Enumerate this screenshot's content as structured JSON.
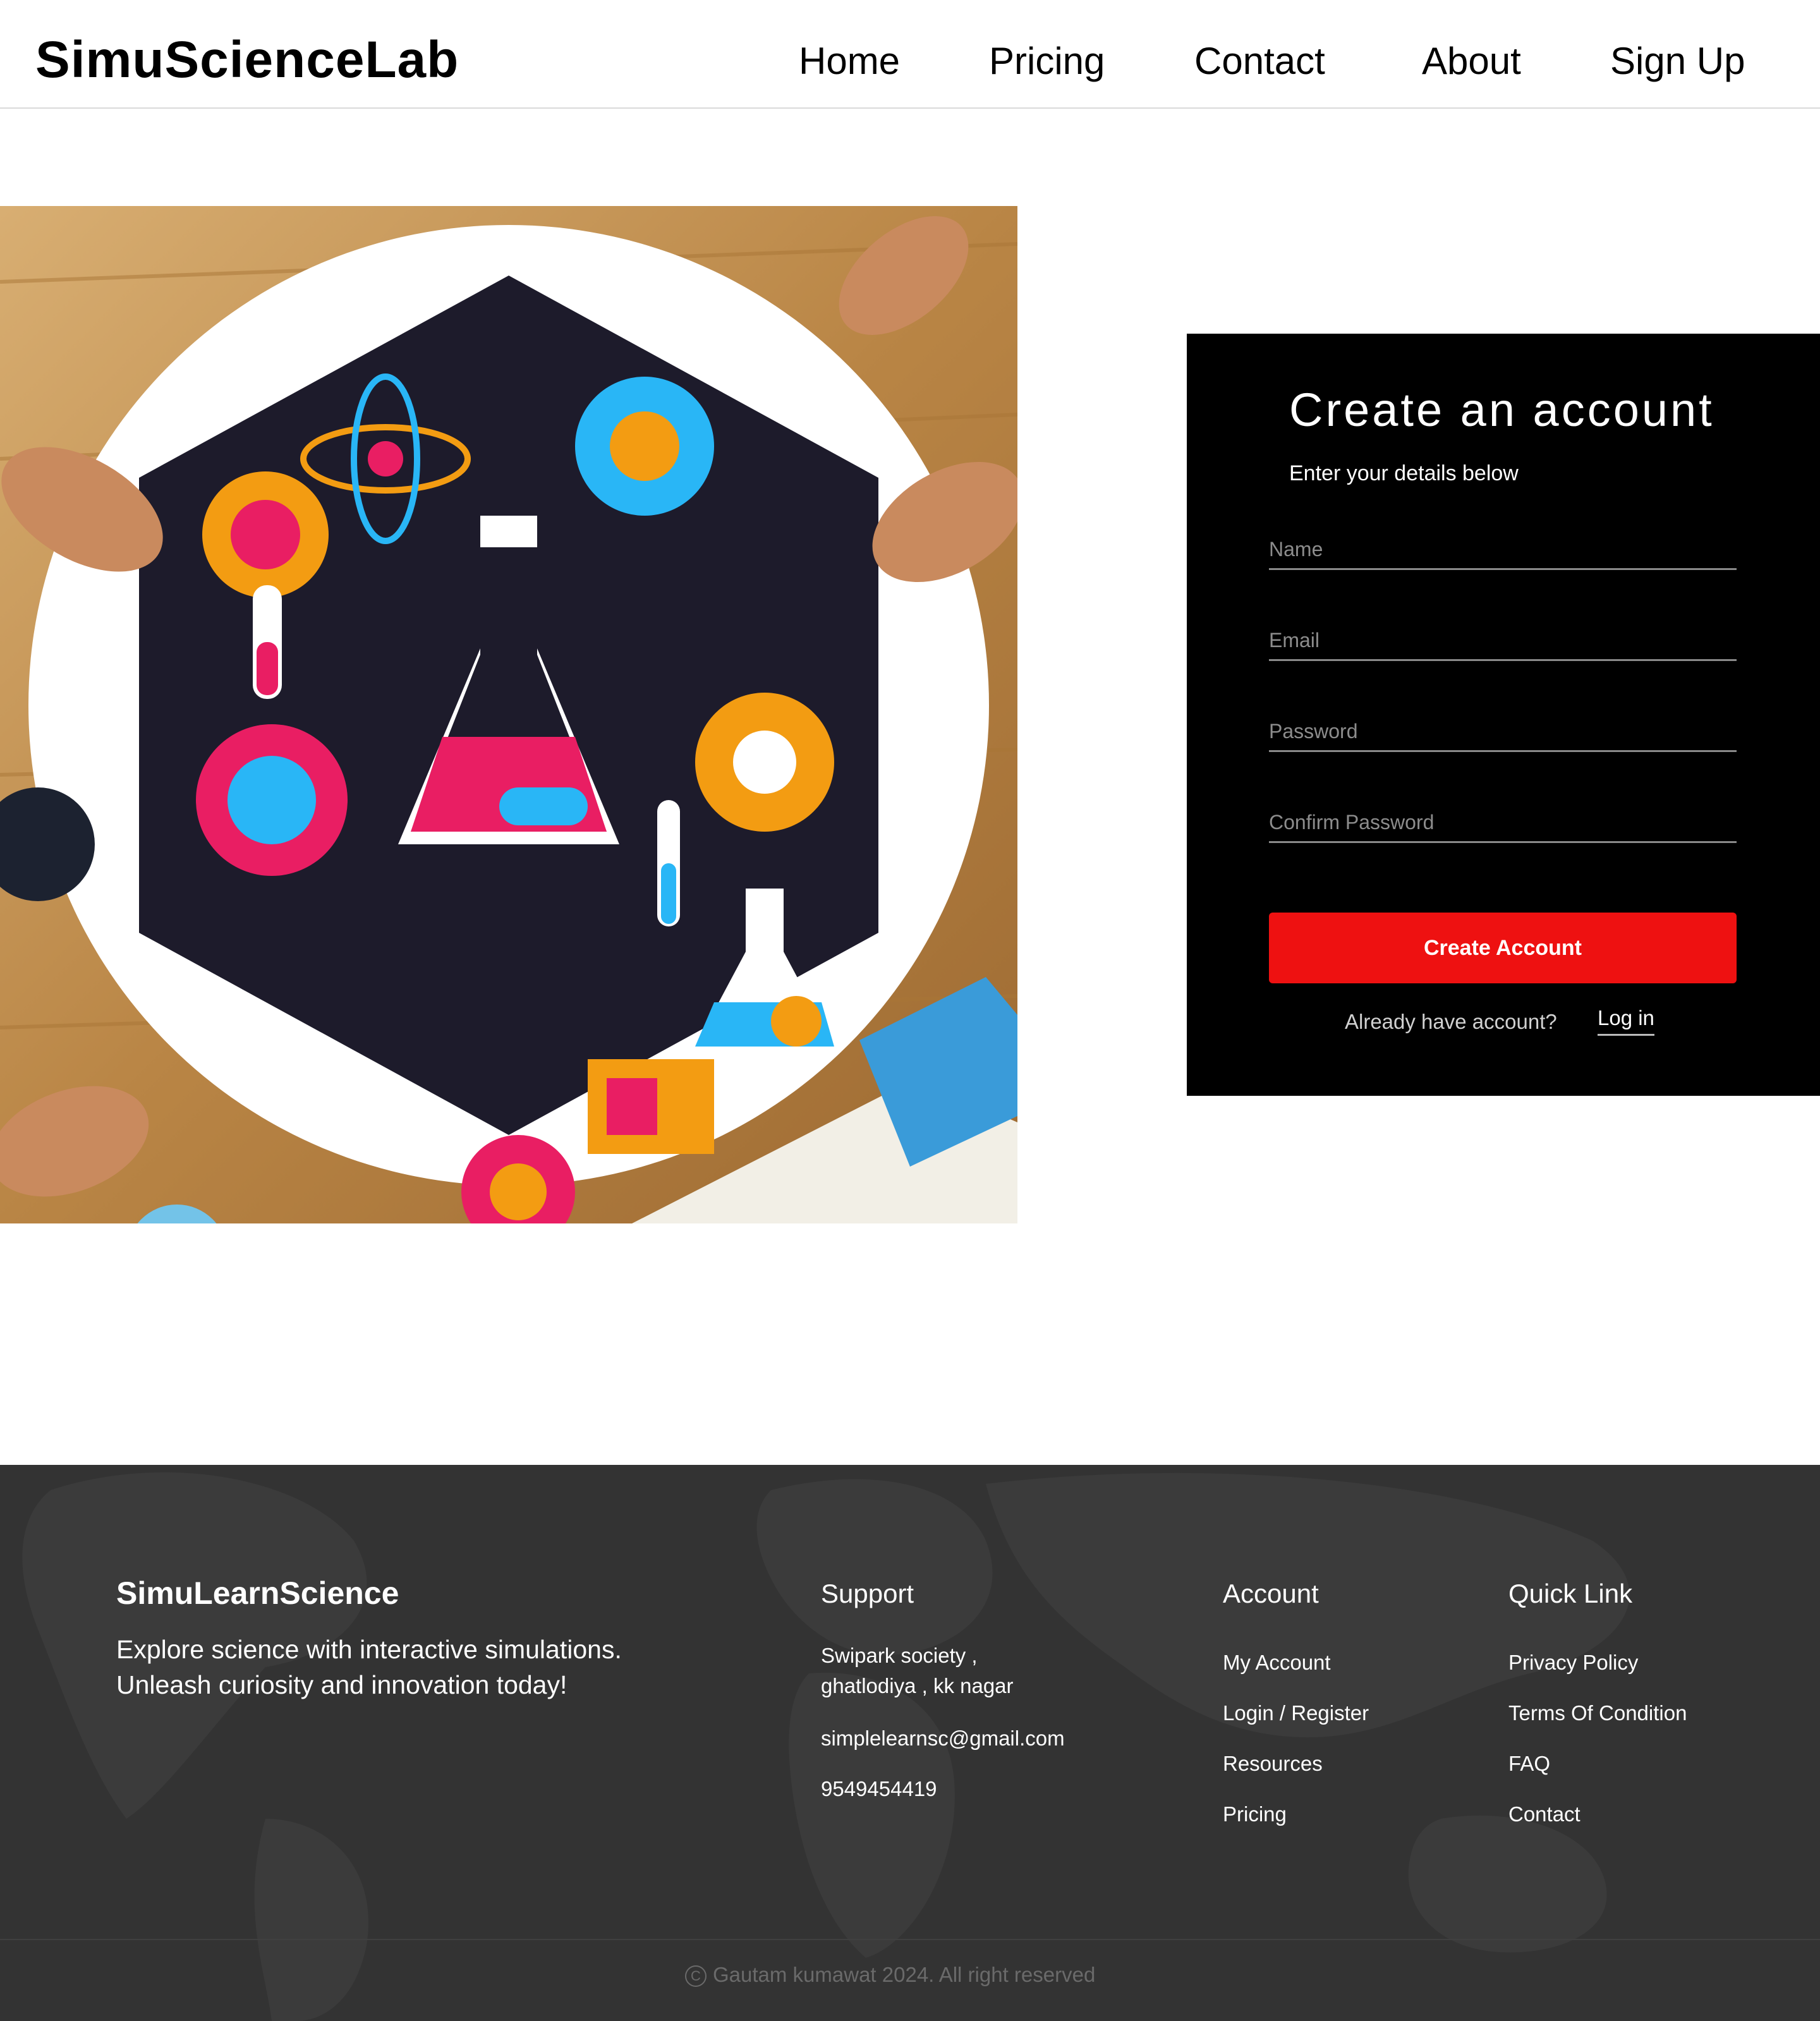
{
  "header": {
    "logo": "SimuScienceLab",
    "nav": {
      "home": "Home",
      "pricing": "Pricing",
      "contact": "Contact",
      "about": "About",
      "signup": "Sign Up"
    }
  },
  "hero": {
    "image_icon": "science-lab-illustration"
  },
  "signup": {
    "title": "Create an account",
    "subtitle": "Enter your details below",
    "fields": {
      "name_placeholder": "Name",
      "email_placeholder": "Email",
      "password_placeholder": "Password",
      "confirm_placeholder": "Confirm Password"
    },
    "submit_label": "Create Account",
    "already_text": "Already have account?",
    "login_label": "Log in",
    "button_color": "#ee1111"
  },
  "footer": {
    "brand": "SimuLearnScience",
    "tagline_line1": "Explore science with interactive simulations.",
    "tagline_line2": "Unleash curiosity and innovation today!",
    "support": {
      "heading": "Support",
      "address_line1": "Swipark society ,",
      "address_line2": "ghatlodiya , kk nagar",
      "email": "simplelearnsc@gmail.com",
      "phone": "9549454419"
    },
    "account": {
      "heading": "Account",
      "items": [
        "My Account",
        "Login / Register",
        "Resources",
        "Pricing"
      ]
    },
    "quick": {
      "heading": "Quick Link",
      "items": [
        "Privacy Policy",
        "Terms Of Condition",
        "FAQ",
        "Contact"
      ]
    },
    "copyright": "Gautam kumawat 2024. All right reserved",
    "copyright_icon": "copyright-icon"
  }
}
